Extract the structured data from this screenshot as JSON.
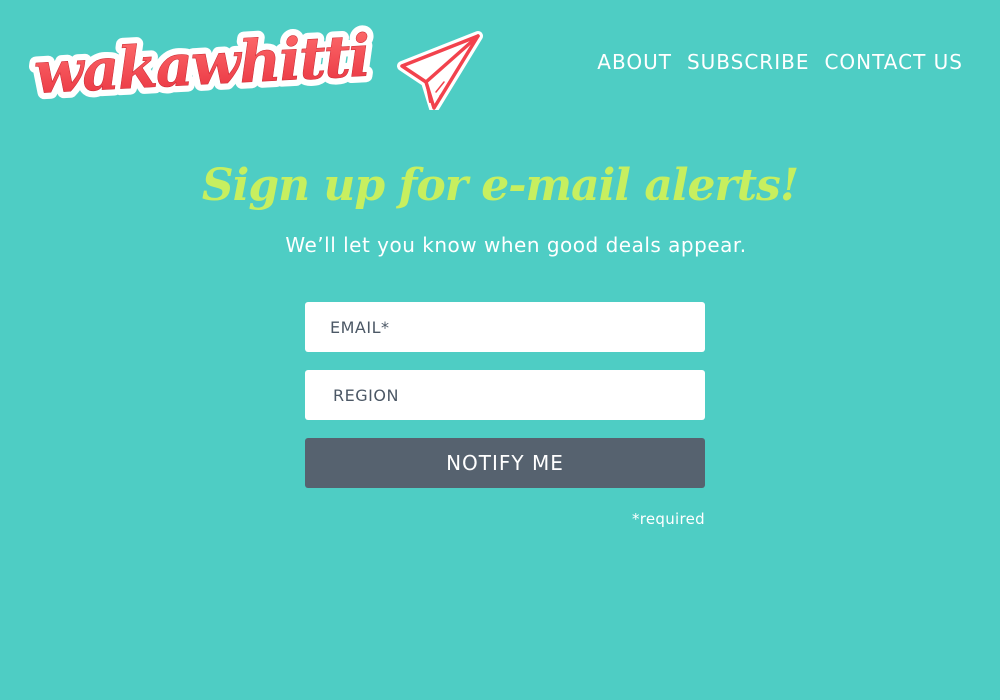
{
  "brand": {
    "name": "wakawhitti",
    "colors": {
      "background": "#4ecdc4",
      "logo_red": "#f2424d",
      "logo_outline": "#ffffff",
      "headline": "#c7ef5f",
      "button": "#56626f",
      "field_text": "#4c5866"
    },
    "icon": "paper-plane-icon"
  },
  "nav": {
    "items": [
      {
        "label": "ABOUT"
      },
      {
        "label": "SUBSCRIBE"
      },
      {
        "label": "CONTACT US"
      }
    ]
  },
  "signup": {
    "headline": "Sign up for e-mail alerts!",
    "subhead": "We’ll let you know when good deals appear.",
    "email_placeholder": "EMAIL*",
    "region_placeholder": "REGION",
    "submit_label": "NOTIFY ME",
    "required_note": "*required"
  }
}
